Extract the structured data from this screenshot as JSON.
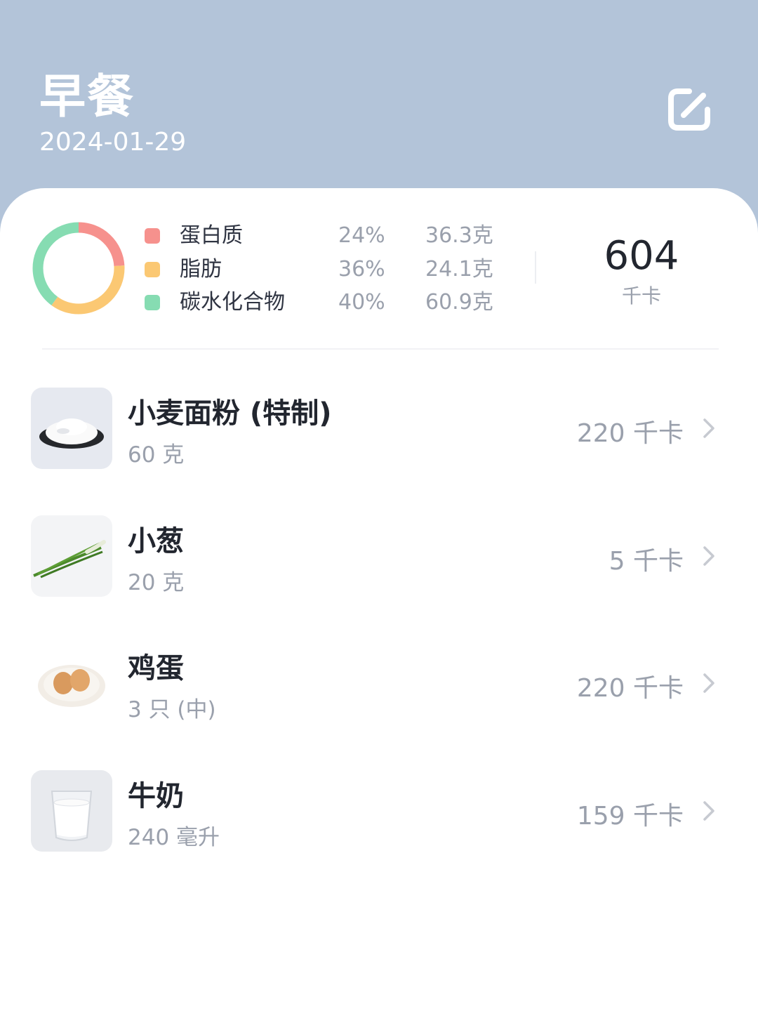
{
  "header": {
    "meal_title": "早餐",
    "date": "2024-01-29",
    "edit_icon": "edit-icon"
  },
  "summary": {
    "macros": [
      {
        "name": "蛋白质",
        "percent": "24%",
        "amount": "36.3克",
        "color": "#f6918d"
      },
      {
        "name": "脂肪",
        "percent": "36%",
        "amount": "24.1克",
        "color": "#fbc873"
      },
      {
        "name": "碳水化合物",
        "percent": "40%",
        "amount": "60.9克",
        "color": "#86dcb2"
      }
    ],
    "total_kcal": "604",
    "total_unit": "千卡"
  },
  "foods": [
    {
      "name": "小麦面粉 (特制)",
      "amount": "60 克",
      "kcal": "220 千卡"
    },
    {
      "name": "小葱",
      "amount": "20 克",
      "kcal": "5 千卡"
    },
    {
      "name": "鸡蛋",
      "amount": "3 只 (中)",
      "kcal": "220 千卡"
    },
    {
      "name": "牛奶",
      "amount": "240 毫升",
      "kcal": "159 千卡"
    }
  ]
}
